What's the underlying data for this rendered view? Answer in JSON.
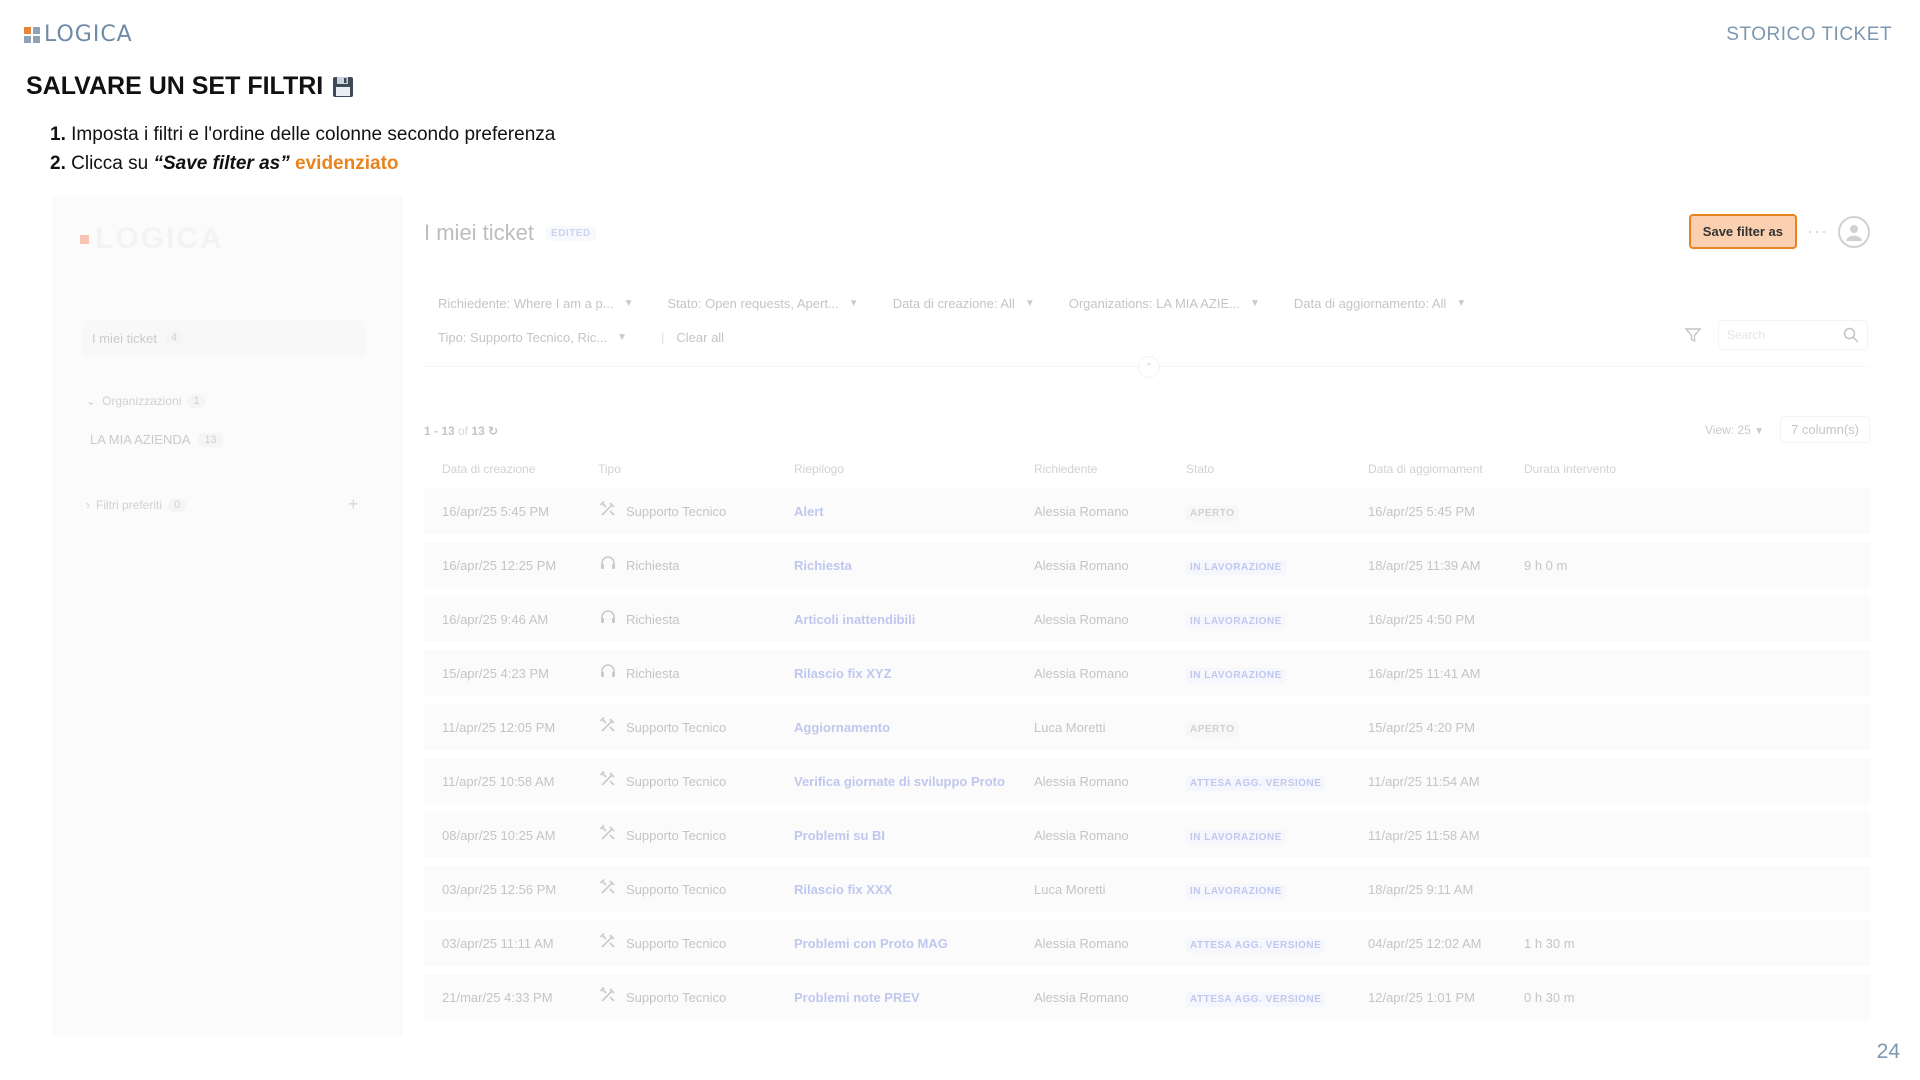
{
  "slide": {
    "logo_text": "LOGICA",
    "section_title": "STORICO TICKET",
    "title": "SALVARE UN SET FILTRI",
    "steps": [
      {
        "num": "1.",
        "text": "Imposta i filtri e l'ordine delle colonne secondo preferenza"
      },
      {
        "num": "2.",
        "pre": "Clicca su ",
        "quoted": "“Save filter as”",
        "highlight": " evidenziato"
      }
    ],
    "page_number": "24",
    "accent_color": "#e8841f"
  },
  "sidebar": {
    "logo_text": "LOGICA",
    "active_item": {
      "label": "I miei ticket",
      "count": "4"
    },
    "group_orgs": {
      "label": "Organizzazioni",
      "count": "1"
    },
    "org_item": {
      "label": "LA MIA AZIENDA",
      "count": "13"
    },
    "group_fav": {
      "label": "Filtri preferiti",
      "count": "0"
    }
  },
  "main": {
    "title": "I miei ticket",
    "edited_badge": "EDITED",
    "save_button": "Save filter as",
    "filters_row1": [
      "Richiedente: Where I am a p...",
      "Stato: Open requests, Apert...",
      "Data di creazione: All",
      "Organizations: LA MIA AZIE...",
      "Data di aggiornamento: All"
    ],
    "filter_tipo": "Tipo: Supporto Tecnico, Ric...",
    "clear_all": "Clear all",
    "search_placeholder": "Search",
    "results": {
      "range": "1 - 13",
      "of": "of",
      "total": "13"
    },
    "view": "View: 25",
    "columns_button": "7 column(s)",
    "columns": [
      "Data di creazione",
      "Tipo",
      "Riepilogo",
      "Richiedente",
      "Stato",
      "Data di aggiornament",
      "Durata intervento"
    ],
    "rows": [
      {
        "created": "16/apr/25 5:45 PM",
        "type": "Supporto Tecnico",
        "type_icon": "tools-icon",
        "summary": "Alert",
        "requester": "Alessia Romano",
        "status": "APERTO",
        "status_kind": "open",
        "updated": "16/apr/25 5:45 PM",
        "duration": ""
      },
      {
        "created": "16/apr/25 12:25 PM",
        "type": "Richiesta",
        "type_icon": "headset-icon",
        "summary": "Richiesta",
        "requester": "Alessia Romano",
        "status": "IN LAVORAZIONE",
        "status_kind": "work",
        "updated": "18/apr/25 11:39 AM",
        "duration": "9 h 0 m"
      },
      {
        "created": "16/apr/25 9:46 AM",
        "type": "Richiesta",
        "type_icon": "headset-icon",
        "summary": "Articoli inattendibili",
        "requester": "Alessia Romano",
        "status": "IN LAVORAZIONE",
        "status_kind": "work",
        "updated": "16/apr/25 4:50 PM",
        "duration": ""
      },
      {
        "created": "15/apr/25 4:23 PM",
        "type": "Richiesta",
        "type_icon": "headset-icon",
        "summary": "Rilascio fix XYZ",
        "requester": "Alessia Romano",
        "status": "IN LAVORAZIONE",
        "status_kind": "work",
        "updated": "16/apr/25 11:41 AM",
        "duration": ""
      },
      {
        "created": "11/apr/25 12:05 PM",
        "type": "Supporto Tecnico",
        "type_icon": "tools-icon",
        "summary": "Aggiornamento",
        "requester": "Luca Moretti",
        "status": "APERTO",
        "status_kind": "open",
        "updated": "15/apr/25 4:20 PM",
        "duration": ""
      },
      {
        "created": "11/apr/25 10:58 AM",
        "type": "Supporto Tecnico",
        "type_icon": "tools-icon",
        "summary": "Verifica giornate di sviluppo Proto",
        "requester": "Alessia Romano",
        "status": "ATTESA AGG. VERSIONE",
        "status_kind": "wait",
        "updated": "11/apr/25 11:54 AM",
        "duration": ""
      },
      {
        "created": "08/apr/25 10:25 AM",
        "type": "Supporto Tecnico",
        "type_icon": "tools-icon",
        "summary": "Problemi su BI",
        "requester": "Alessia Romano",
        "status": "IN LAVORAZIONE",
        "status_kind": "work",
        "updated": "11/apr/25 11:58 AM",
        "duration": ""
      },
      {
        "created": "03/apr/25 12:56 PM",
        "type": "Supporto Tecnico",
        "type_icon": "tools-icon",
        "summary": "Rilascio fix XXX",
        "requester": "Luca Moretti",
        "status": "IN LAVORAZIONE",
        "status_kind": "work",
        "updated": "18/apr/25 9:11 AM",
        "duration": ""
      },
      {
        "created": "03/apr/25 11:11 AM",
        "type": "Supporto Tecnico",
        "type_icon": "tools-icon",
        "summary": "Problemi con Proto MAG",
        "requester": "Alessia Romano",
        "status": "ATTESA AGG. VERSIONE",
        "status_kind": "wait",
        "updated": "04/apr/25 12:02 AM",
        "duration": "1 h 30 m"
      },
      {
        "created": "21/mar/25 4:33 PM",
        "type": "Supporto Tecnico",
        "type_icon": "tools-icon",
        "summary": "Problemi note PREV",
        "requester": "Alessia Romano",
        "status": "ATTESA AGG. VERSIONE",
        "status_kind": "wait",
        "updated": "12/apr/25 1:01 PM",
        "duration": "0 h 30 m"
      }
    ]
  }
}
